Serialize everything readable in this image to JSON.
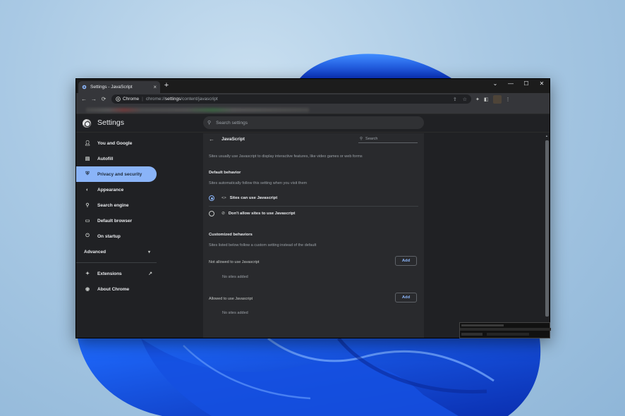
{
  "window": {
    "tab_title": "Settings - JavaScript",
    "tab_close": "×",
    "new_tab": "+",
    "controls": {
      "dropdown": "⌄",
      "minimize": "—",
      "maximize": "☐",
      "close": "✕"
    }
  },
  "toolbar": {
    "back": "←",
    "forward": "→",
    "reload": "⟳",
    "site_label": "Chrome",
    "url_prefix": "chrome://",
    "url_host": "settings",
    "url_path": "/content/javascript"
  },
  "settings": {
    "title": "Settings",
    "search_placeholder": "Search settings"
  },
  "sidebar": {
    "items": [
      {
        "label": "You and Google",
        "icon": "person-icon"
      },
      {
        "label": "Autofill",
        "icon": "clipboard-icon"
      },
      {
        "label": "Privacy and security",
        "icon": "shield-icon",
        "active": true
      },
      {
        "label": "Appearance",
        "icon": "palette-icon"
      },
      {
        "label": "Search engine",
        "icon": "search-icon"
      },
      {
        "label": "Default browser",
        "icon": "browser-icon"
      },
      {
        "label": "On startup",
        "icon": "power-icon"
      }
    ],
    "advanced_label": "Advanced",
    "extensions_label": "Extensions",
    "about_label": "About Chrome"
  },
  "page": {
    "title": "JavaScript",
    "search_placeholder": "Search",
    "description": "Sites usually use Javascript to display interactive features, like video games or web forms",
    "default_behavior": {
      "heading": "Default behavior",
      "subtitle": "Sites automatically follow this setting when you visit them",
      "options": [
        {
          "label": "Sites can use Javascript",
          "selected": true
        },
        {
          "label": "Don't allow sites to use Javascript",
          "selected": false
        }
      ]
    },
    "customized": {
      "heading": "Customized behaviors",
      "subtitle": "Sites listed below follow a custom setting instead of the default",
      "not_allowed_label": "Not allowed to use Javascript",
      "allowed_label": "Allowed to use Javascript",
      "add_label": "Add",
      "empty_label": "No sites added"
    }
  },
  "colors": {
    "accent": "#8ab4f8",
    "background": "#202124",
    "card": "#292a2d"
  }
}
